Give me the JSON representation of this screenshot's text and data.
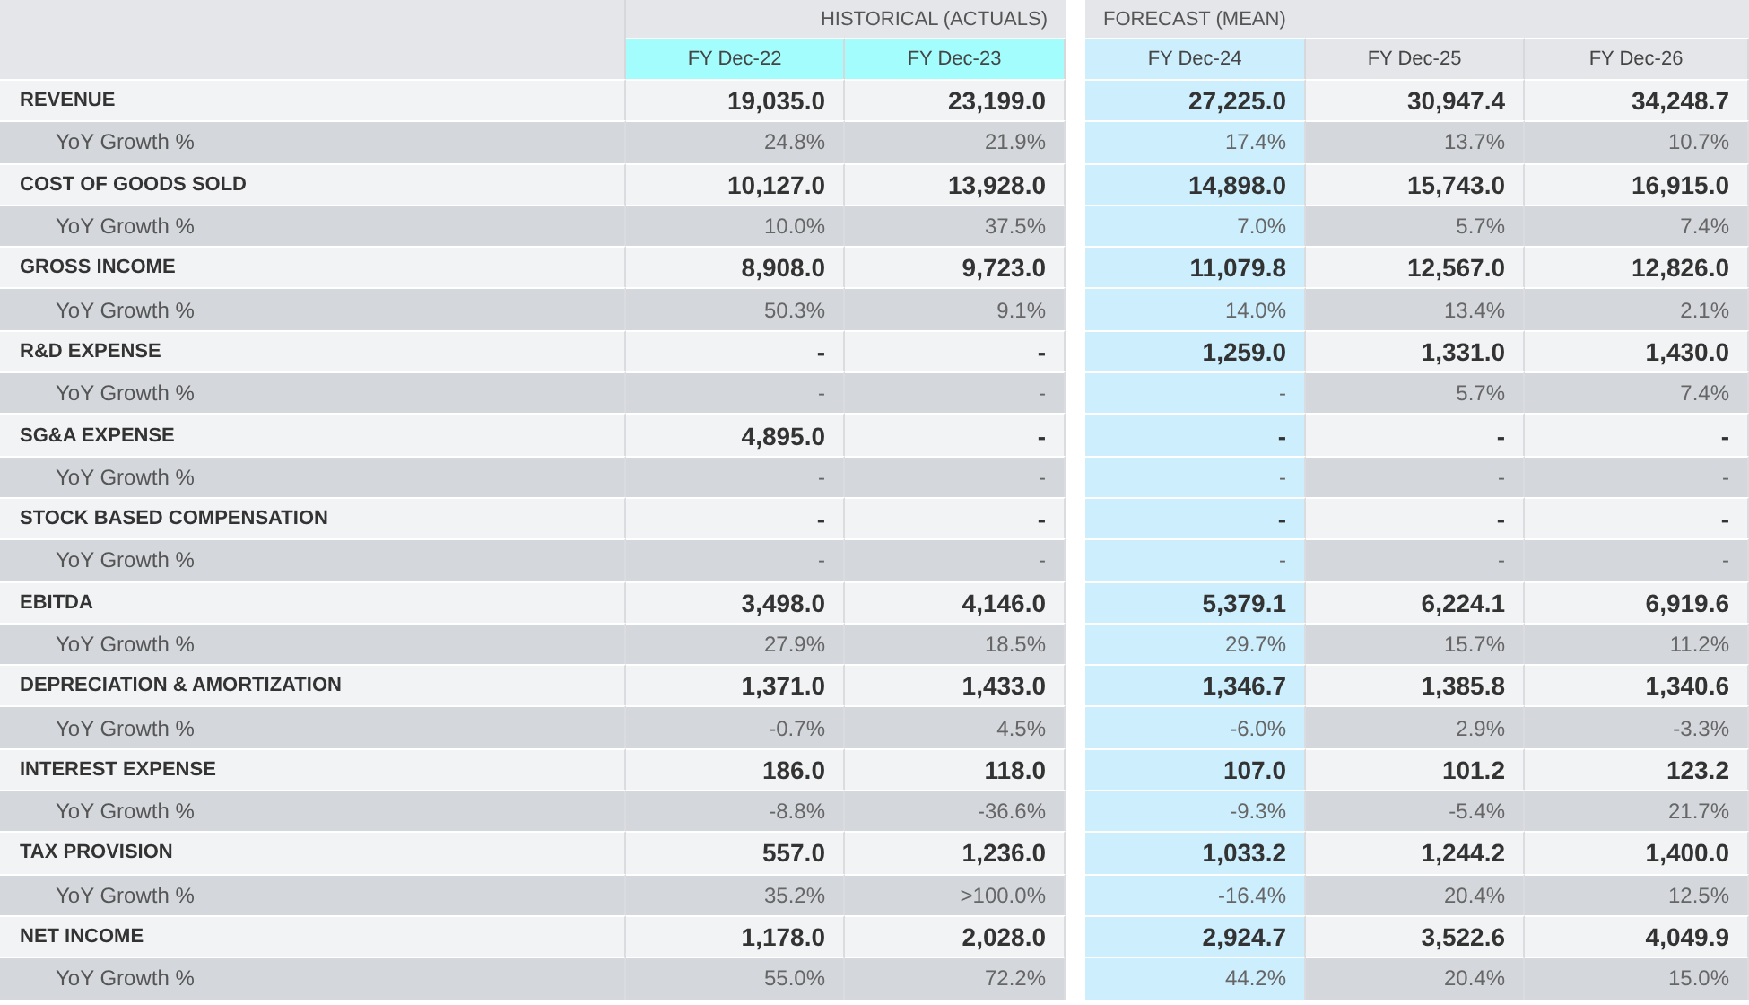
{
  "groups": [
    {
      "label": "HISTORICAL (ACTUALS)",
      "columns": [
        {
          "label": "FY Dec-22",
          "kind": "actual"
        },
        {
          "label": "FY Dec-23",
          "kind": "actual"
        }
      ]
    },
    {
      "label": "FORECAST (MEAN)",
      "columns": [
        {
          "label": "FY Dec-24",
          "kind": "current"
        },
        {
          "label": "FY Dec-25",
          "kind": "estimate"
        },
        {
          "label": "FY Dec-26",
          "kind": "estimate"
        }
      ]
    }
  ],
  "rows": [
    {
      "label": "REVENUE",
      "kind": "metric",
      "values": [
        "19,035.0",
        "23,199.0",
        "27,225.0",
        "30,947.4",
        "34,248.7"
      ]
    },
    {
      "label": "YoY Growth %",
      "kind": "growth",
      "values": [
        "24.8%",
        "21.9%",
        "17.4%",
        "13.7%",
        "10.7%"
      ]
    },
    {
      "label": "COST OF GOODS SOLD",
      "kind": "metric",
      "values": [
        "10,127.0",
        "13,928.0",
        "14,898.0",
        "15,743.0",
        "16,915.0"
      ]
    },
    {
      "label": "YoY Growth %",
      "kind": "growth",
      "values": [
        "10.0%",
        "37.5%",
        "7.0%",
        "5.7%",
        "7.4%"
      ]
    },
    {
      "label": "GROSS INCOME",
      "kind": "metric",
      "values": [
        "8,908.0",
        "9,723.0",
        "11,079.8",
        "12,567.0",
        "12,826.0"
      ]
    },
    {
      "label": "YoY Growth %",
      "kind": "growth",
      "values": [
        "50.3%",
        "9.1%",
        "14.0%",
        "13.4%",
        "2.1%"
      ]
    },
    {
      "label": "R&D EXPENSE",
      "kind": "metric",
      "values": [
        "-",
        "-",
        "1,259.0",
        "1,331.0",
        "1,430.0"
      ]
    },
    {
      "label": "YoY Growth %",
      "kind": "growth",
      "values": [
        "-",
        "-",
        "-",
        "5.7%",
        "7.4%"
      ]
    },
    {
      "label": "SG&A EXPENSE",
      "kind": "metric",
      "values": [
        "4,895.0",
        "-",
        "-",
        "-",
        "-"
      ]
    },
    {
      "label": "YoY Growth %",
      "kind": "growth",
      "values": [
        "-",
        "-",
        "-",
        "-",
        "-"
      ]
    },
    {
      "label": "STOCK BASED COMPENSATION",
      "kind": "metric",
      "values": [
        "-",
        "-",
        "-",
        "-",
        "-"
      ]
    },
    {
      "label": "YoY Growth %",
      "kind": "growth",
      "values": [
        "-",
        "-",
        "-",
        "-",
        "-"
      ]
    },
    {
      "label": "EBITDA",
      "kind": "metric",
      "values": [
        "3,498.0",
        "4,146.0",
        "5,379.1",
        "6,224.1",
        "6,919.6"
      ]
    },
    {
      "label": "YoY Growth %",
      "kind": "growth",
      "values": [
        "27.9%",
        "18.5%",
        "29.7%",
        "15.7%",
        "11.2%"
      ]
    },
    {
      "label": "DEPRECIATION & AMORTIZATION",
      "kind": "metric",
      "values": [
        "1,371.0",
        "1,433.0",
        "1,346.7",
        "1,385.8",
        "1,340.6"
      ]
    },
    {
      "label": "YoY Growth %",
      "kind": "growth",
      "values": [
        "-0.7%",
        "4.5%",
        "-6.0%",
        "2.9%",
        "-3.3%"
      ]
    },
    {
      "label": "INTEREST EXPENSE",
      "kind": "metric",
      "values": [
        "186.0",
        "118.0",
        "107.0",
        "101.2",
        "123.2"
      ]
    },
    {
      "label": "YoY Growth %",
      "kind": "growth",
      "values": [
        "-8.8%",
        "-36.6%",
        "-9.3%",
        "-5.4%",
        "21.7%"
      ]
    },
    {
      "label": "TAX PROVISION",
      "kind": "metric",
      "values": [
        "557.0",
        "1,236.0",
        "1,033.2",
        "1,244.2",
        "1,400.0"
      ]
    },
    {
      "label": "YoY Growth %",
      "kind": "growth",
      "values": [
        "35.2%",
        ">100.0%",
        "-16.4%",
        "20.4%",
        "12.5%"
      ]
    },
    {
      "label": "NET INCOME",
      "kind": "metric",
      "values": [
        "1,178.0",
        "2,028.0",
        "2,924.7",
        "3,522.6",
        "4,049.9"
      ]
    },
    {
      "label": "YoY Growth %",
      "kind": "growth",
      "values": [
        "55.0%",
        "72.2%",
        "44.2%",
        "20.4%",
        "15.0%"
      ]
    }
  ]
}
